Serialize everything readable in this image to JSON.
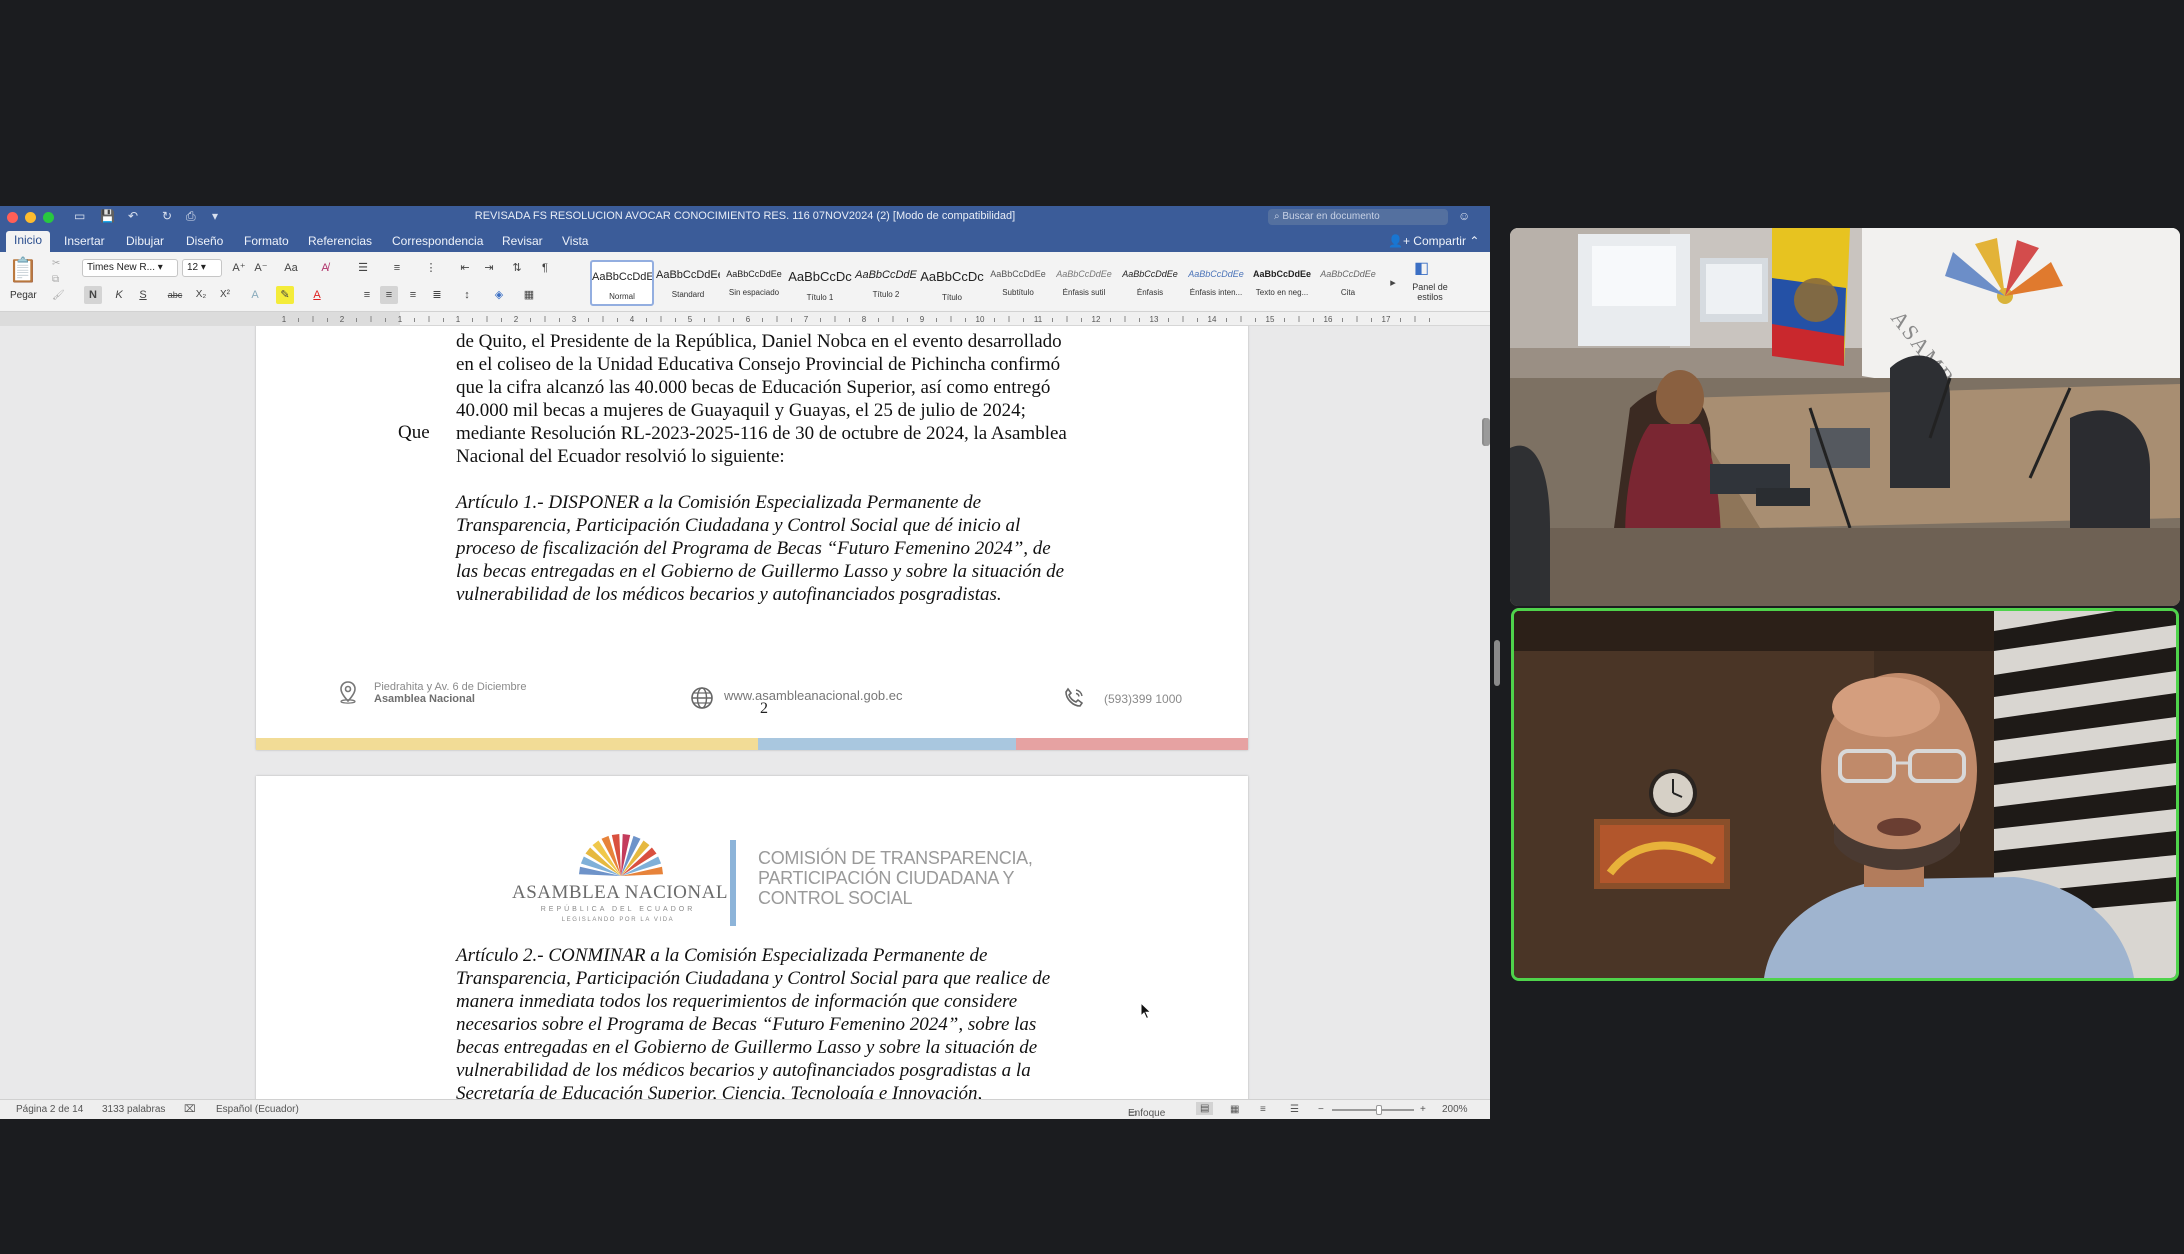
{
  "window": {
    "title": "REVISADA FS RESOLUCION AVOCAR CONOCIMIENTO RES. 116 07NOV2024 (2) [Modo de compatibilidad]",
    "search_placeholder": "Buscar en documento",
    "share_label": "Compartir"
  },
  "tabs": [
    "Inicio",
    "Insertar",
    "Dibujar",
    "Diseño",
    "Formato",
    "Referencias",
    "Correspondencia",
    "Revisar",
    "Vista"
  ],
  "ribbon": {
    "paste_label": "Pegar",
    "font_name": "Times New R...",
    "font_size": "12",
    "bold": "N",
    "italic": "K",
    "underline": "S",
    "strike": "abc",
    "subscript": "X₂",
    "superscript": "X²",
    "styles_panel_label": "Panel de estilos",
    "styles": [
      {
        "sample": "AaBbCcDdEe",
        "name": "Normal"
      },
      {
        "sample": "AaBbCcDdEe",
        "name": "Standard"
      },
      {
        "sample": "AaBbCcDdEe",
        "name": "Sin espaciado"
      },
      {
        "sample": "AaBbCcDc",
        "name": "Título 1"
      },
      {
        "sample": "AaBbCcDdE",
        "name": "Título 2"
      },
      {
        "sample": "AaBbCcDc",
        "name": "Título"
      },
      {
        "sample": "AaBbCcDdEe",
        "name": "Subtítulo"
      },
      {
        "sample": "AaBbCcDdEe",
        "name": "Énfasis sutil"
      },
      {
        "sample": "AaBbCcDdEe",
        "name": "Énfasis"
      },
      {
        "sample": "AaBbCcDdEe",
        "name": "Énfasis inten..."
      },
      {
        "sample": "AaBbCcDdEe",
        "name": "Texto en neg..."
      },
      {
        "sample": "AaBbCcDdEe",
        "name": "Cita"
      }
    ]
  },
  "ruler_marks": [
    "1",
    "2",
    "1",
    "1",
    "2",
    "3",
    "4",
    "5",
    "6",
    "7",
    "8",
    "9",
    "10",
    "11",
    "12",
    "13",
    "14",
    "15",
    "16",
    "17"
  ],
  "page2": {
    "para1_lines": [
      "de Quito, el Presidente de la República, Daniel Nobca en el evento desarrollado",
      "en el coliseo de la Unidad Educativa Consejo Provincial de Pichincha confirmó",
      "que la cifra alcanzó las 40.000 becas de Educación Superior, así como entregó",
      "40.000 mil becas a mujeres de Guayaquil y Guayas, el 25 de julio de 2024;"
    ],
    "que_label": "Que",
    "para2_lines": [
      "mediante Resolución RL-2023-2025-116 de 30 de octubre de 2024, la Asamblea",
      "Nacional del Ecuador resolvió lo siguiente:"
    ],
    "article1_lines": [
      "Artículo 1.- DISPONER a la Comisión Especializada Permanente de",
      "Transparencia, Participación Ciudadana y Control Social que dé inicio al",
      "proceso de fiscalización del Programa de Becas “Futuro Femenino 2024”, de",
      "las becas entregadas en el Gobierno de Guillermo Lasso y sobre la situación de",
      "vulnerabilidad de los médicos becarios y autofinanciados posgradistas."
    ],
    "footer": {
      "address_line1": "Piedrahita y Av. 6 de Diciembre",
      "address_line2": "Asamblea Nacional",
      "website": "www.asambleanacional.gob.ec",
      "phone": "(593)399 1000",
      "page_number": "2"
    },
    "band_colors": [
      "#f2dc96",
      "#a9c7df",
      "#e6a2a2"
    ]
  },
  "page3": {
    "logo_name": "ASAMBLEA NACIONAL",
    "logo_sub": "REPÚBLICA DEL ECUADOR",
    "logo_tagline": "LEGISLANDO POR LA VIDA",
    "commission_lines": [
      "COMISIÓN DE TRANSPARENCIA,",
      "PARTICIPACIÓN CIUDADANA Y",
      "CONTROL SOCIAL"
    ],
    "article2_lines": [
      "Artículo 2.- CONMINAR a la Comisión Especializada Permanente de",
      "Transparencia, Participación Ciudadana y Control Social para que realice de",
      "manera inmediata todos los requerimientos de información que considere",
      "necesarios sobre el Programa de Becas “Futuro Femenino 2024”, sobre las",
      "becas entregadas en el Gobierno de Guillermo Lasso y sobre la situación de",
      "vulnerabilidad de los médicos becarios y autofinanciados posgradistas a la",
      "Secretaría de Educación Superior, Ciencia, Tecnología e Innovación,"
    ]
  },
  "status": {
    "page": "Página 2 de 14",
    "words": "3133 palabras",
    "language": "Español (Ecuador)",
    "focus": "Enfoque",
    "zoom": "200%"
  },
  "video": {
    "tile1_banner": "ASAMBLEA NACIONAL"
  }
}
